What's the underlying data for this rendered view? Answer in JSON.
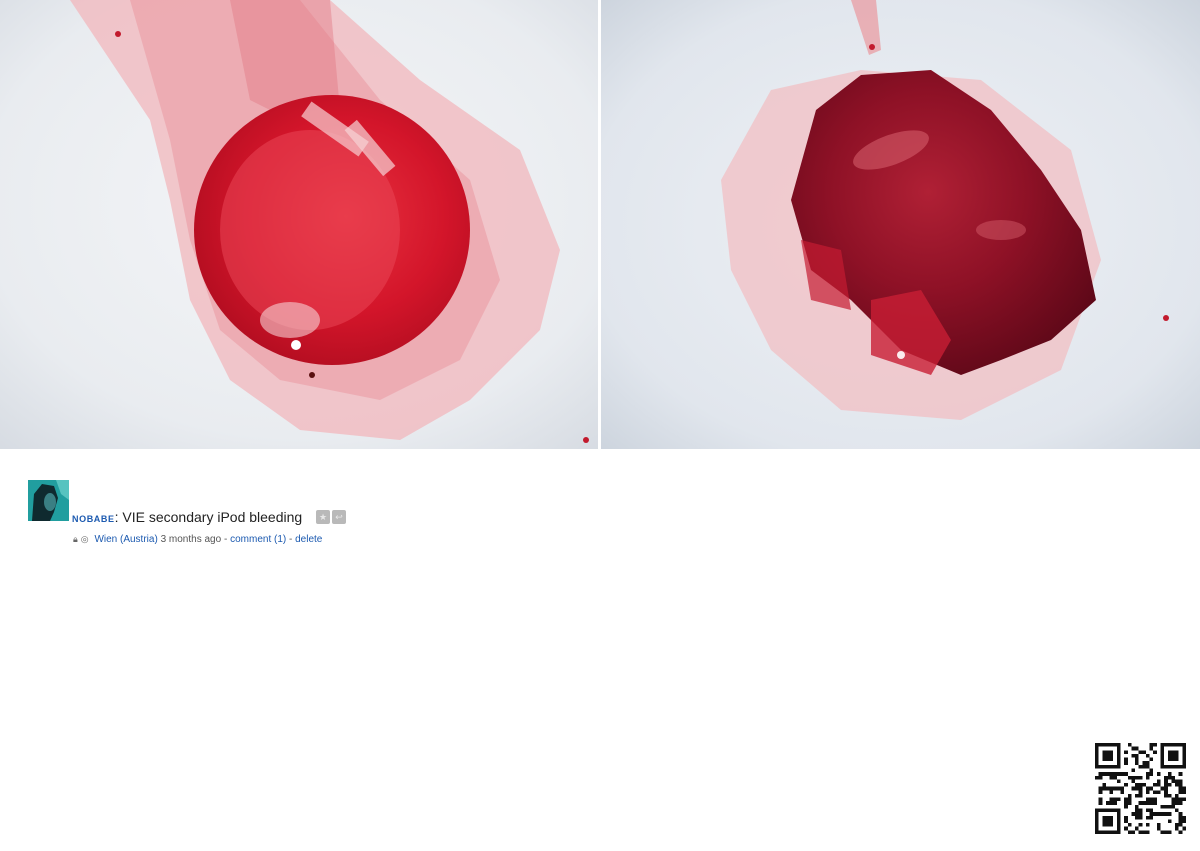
{
  "photos": [
    {
      "name": "bleeding-pool-photo"
    },
    {
      "name": "clotted-blood-photo"
    }
  ],
  "post": {
    "username": "NOBABE",
    "separator": ":",
    "status": "VIE secondary iPod bleeding",
    "meta": {
      "location": "Wien (Austria)",
      "time": "3 months ago",
      "dash1": "-",
      "comment_link": "comment (1)",
      "dash2": "-",
      "delete_link": "delete"
    }
  },
  "icons": {
    "lock": "lock-icon",
    "globe": "globe-icon",
    "action1": "star-icon",
    "action2": "reply-icon"
  }
}
